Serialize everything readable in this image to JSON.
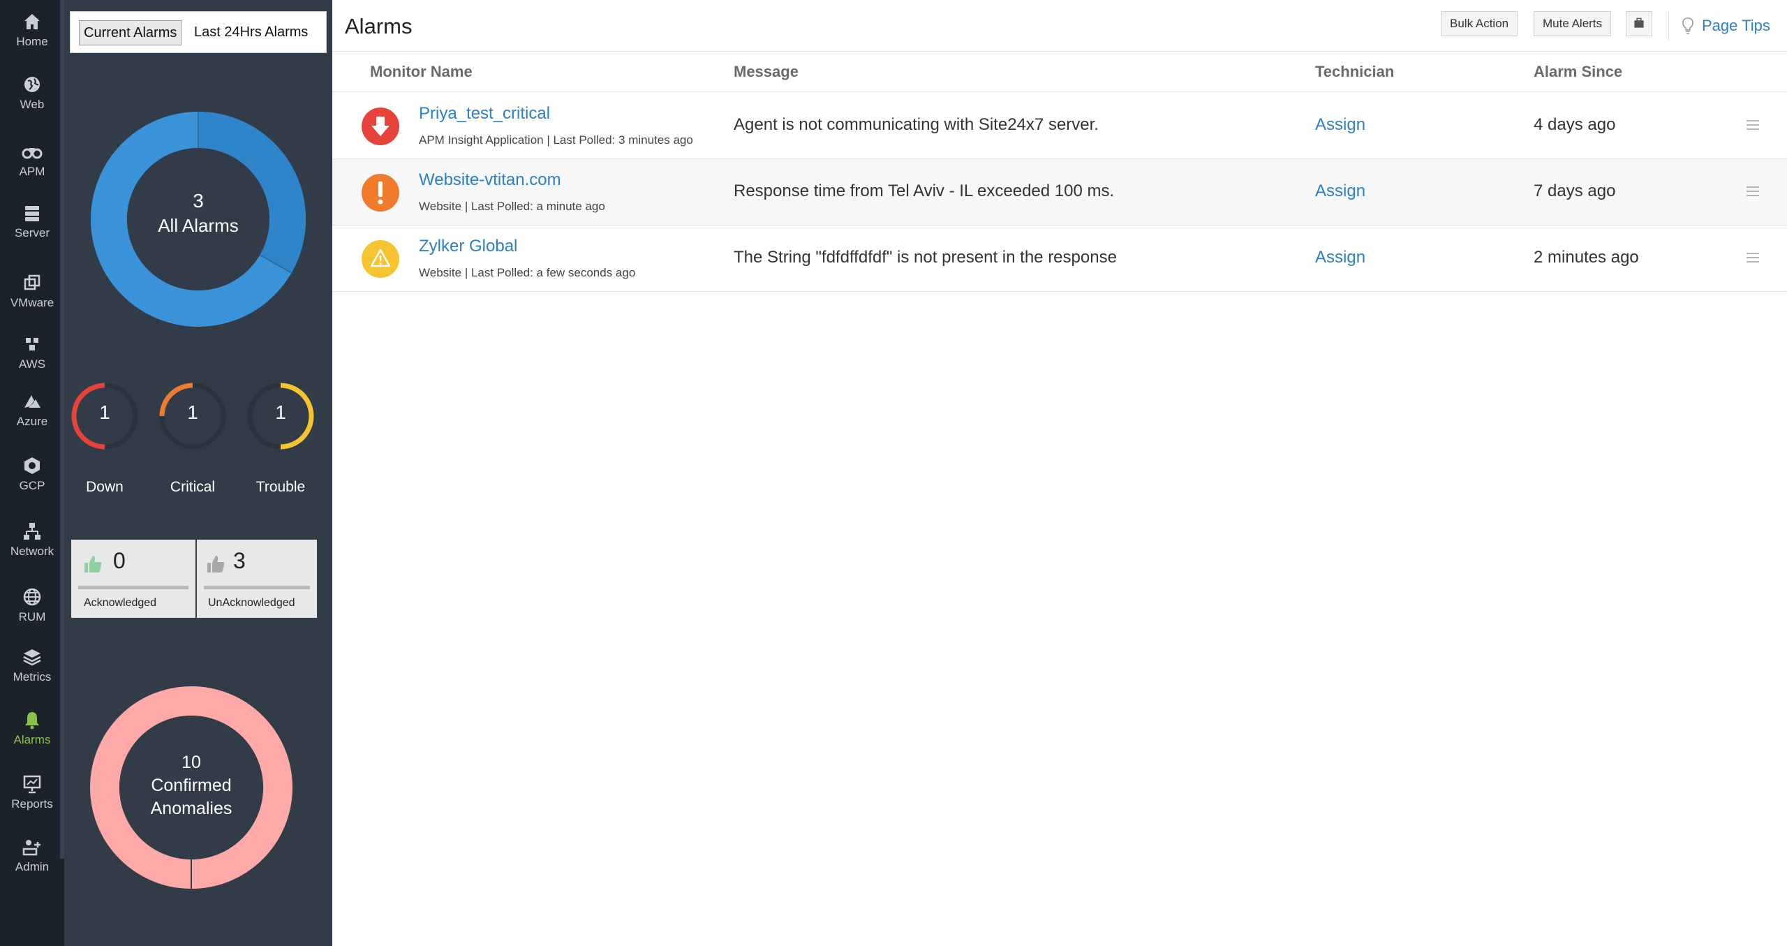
{
  "nav": {
    "items": [
      {
        "label": "Home",
        "icon": "home-icon"
      },
      {
        "label": "Web",
        "icon": "globe-icon"
      },
      {
        "label": "APM",
        "icon": "binoculars-icon"
      },
      {
        "label": "Server",
        "icon": "server-icon"
      },
      {
        "label": "VMware",
        "icon": "vmware-icon"
      },
      {
        "label": "AWS",
        "icon": "aws-icon"
      },
      {
        "label": "Azure",
        "icon": "azure-icon"
      },
      {
        "label": "GCP",
        "icon": "gcp-icon"
      },
      {
        "label": "Network",
        "icon": "network-icon"
      },
      {
        "label": "RUM",
        "icon": "rum-globe-icon"
      },
      {
        "label": "Metrics",
        "icon": "layers-icon"
      },
      {
        "label": "Alarms",
        "icon": "bell-icon",
        "active": true
      },
      {
        "label": "Reports",
        "icon": "reports-icon"
      },
      {
        "label": "Admin",
        "icon": "admin-icon"
      }
    ],
    "active_color": "#8bc34a"
  },
  "summary": {
    "tabs": [
      "Current Alarms",
      "Last 24Hrs Alarms"
    ],
    "active_tab": "Current Alarms",
    "all_alarms": {
      "count": "3",
      "label": "All Alarms"
    },
    "severity": [
      {
        "label": "Down",
        "count": "1",
        "color": "#e8433a"
      },
      {
        "label": "Critical",
        "count": "1",
        "color": "#f07b2c"
      },
      {
        "label": "Trouble",
        "count": "1",
        "color": "#f6c431"
      }
    ],
    "acknowledged": {
      "count": "0",
      "label": "Acknowledged"
    },
    "unacknowledged": {
      "count": "3",
      "label": "UnAcknowledged"
    },
    "anomalies": {
      "count": "10",
      "line1": "Confirmed",
      "line2": "Anomalies",
      "color": "#fda9a7"
    }
  },
  "header": {
    "title": "Alarms",
    "bulk_action": "Bulk Action",
    "mute_alerts": "Mute Alerts",
    "page_tips": "Page Tips"
  },
  "table": {
    "columns": [
      "Monitor Name",
      "Message",
      "Technician",
      "Alarm Since"
    ],
    "rows": [
      {
        "status": "down",
        "name": "Priya_test_critical",
        "sub": "APM Insight Application | Last Polled: 3 minutes ago",
        "message": "Agent is not communicating with Site24x7 server.",
        "technician": "Assign",
        "since": "4 days ago"
      },
      {
        "status": "critical",
        "name": "Website-vtitan.com",
        "sub": "Website | Last Polled: a minute ago",
        "message": "Response time from Tel Aviv - IL exceeded 100 ms.",
        "technician": "Assign",
        "since": "7 days ago"
      },
      {
        "status": "trouble",
        "name": "Zylker Global",
        "sub": "Website | Last Polled: a few seconds ago",
        "message": "The String \"fdfdffdfdf\" is not present in the response",
        "technician": "Assign",
        "since": "2 minutes ago"
      }
    ]
  },
  "colors": {
    "link": "#2b7fc4",
    "panel_bg": "#323c48",
    "rail_bg": "#1c2229",
    "donut_blue": "#3a93d8"
  }
}
